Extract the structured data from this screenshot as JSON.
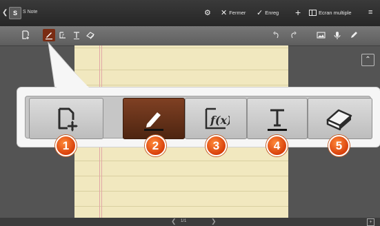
{
  "topbar": {
    "app_icon_letter": "S",
    "app_title": "S Note",
    "close_label": "Fermer",
    "save_label": "Enreg",
    "multiwindow_label": "Ecran multiple"
  },
  "footer": {
    "page_indicator": "1/1"
  },
  "callouts": [
    "1",
    "2",
    "3",
    "4",
    "5"
  ],
  "colors": {
    "selected_tool": "#5e2c14",
    "callout_number": "#e65a1a",
    "paper": "#f1e8bf"
  }
}
